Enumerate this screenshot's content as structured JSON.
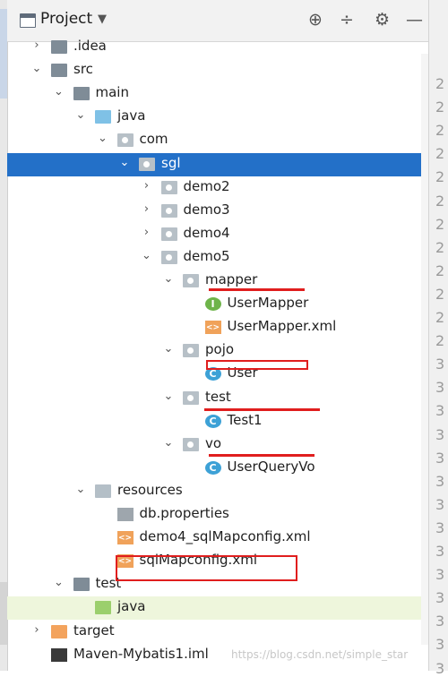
{
  "toolbar": {
    "title": "Project",
    "dropdown": "▼",
    "icons": [
      "target-icon",
      "collapse-icon",
      "gear-icon",
      "minimize-icon"
    ]
  },
  "tree": [
    {
      "label": ".idea",
      "arrow": "›",
      "icon": "folder-icon",
      "depth": 1
    },
    {
      "label": "src",
      "arrow": "⌄",
      "icon": "folder-icon",
      "depth": 1
    },
    {
      "label": "main",
      "arrow": "⌄",
      "icon": "folder-icon",
      "depth": 2
    },
    {
      "label": "java",
      "arrow": "⌄",
      "icon": "source-folder-icon",
      "depth": 3
    },
    {
      "label": "com",
      "arrow": "⌄",
      "icon": "package-icon",
      "depth": 4
    },
    {
      "label": "sgl",
      "arrow": "⌄",
      "icon": "package-icon",
      "depth": 5,
      "selected": true
    },
    {
      "label": "demo2",
      "arrow": "›",
      "icon": "package-icon",
      "depth": 6
    },
    {
      "label": "demo3",
      "arrow": "›",
      "icon": "package-icon",
      "depth": 6
    },
    {
      "label": "demo4",
      "arrow": "›",
      "icon": "package-icon",
      "depth": 6
    },
    {
      "label": "demo5",
      "arrow": "⌄",
      "icon": "package-icon",
      "depth": 6
    },
    {
      "label": "mapper",
      "arrow": "⌄",
      "icon": "package-icon",
      "depth": 7
    },
    {
      "label": "UserMapper",
      "icon": "interface-icon",
      "depth": 8
    },
    {
      "label": "UserMapper.xml",
      "icon": "xml-icon",
      "depth": 8
    },
    {
      "label": "pojo",
      "arrow": "⌄",
      "icon": "package-icon",
      "depth": 7
    },
    {
      "label": "User",
      "icon": "class-icon",
      "depth": 8
    },
    {
      "label": "test",
      "arrow": "⌄",
      "icon": "package-icon",
      "depth": 7
    },
    {
      "label": "Test1",
      "icon": "test-class-icon",
      "depth": 8
    },
    {
      "label": "vo",
      "arrow": "⌄",
      "icon": "package-icon",
      "depth": 7
    },
    {
      "label": "UserQueryVo",
      "icon": "class-icon",
      "depth": 8
    },
    {
      "label": "resources",
      "arrow": "⌄",
      "icon": "resources-folder-icon",
      "depth": 3
    },
    {
      "label": "db.properties",
      "icon": "properties-icon",
      "depth": 4
    },
    {
      "label": "demo4_sqlMapconfig.xml",
      "icon": "xml-icon",
      "depth": 4
    },
    {
      "label": "sqlMapconfig.xml",
      "icon": "xml-icon",
      "depth": 4
    },
    {
      "label": "test",
      "arrow": "⌄",
      "icon": "folder-icon",
      "depth": 2
    },
    {
      "label": "java",
      "icon": "test-source-folder-icon",
      "depth": 3,
      "highlighted": true
    },
    {
      "label": "target",
      "arrow": "›",
      "icon": "excluded-folder-icon",
      "depth": 1
    },
    {
      "label": "Maven-Mybatis1.iml",
      "icon": "iml-icon",
      "depth": 1
    }
  ],
  "gutter_numbers": [
    "2",
    "2",
    "2",
    "2",
    "2",
    "2",
    "2",
    "2",
    "2",
    "2",
    "2",
    "2",
    "3",
    "3",
    "3",
    "3",
    "3",
    "3",
    "3",
    "3",
    "3",
    "3",
    "3",
    "3",
    "3",
    "3"
  ],
  "watermark": "https://blog.csdn.net/simple_star",
  "colors": {
    "selection": "#2370c8",
    "annotation_red": "#e01e1e",
    "highlight_row": "#eef6dc"
  }
}
